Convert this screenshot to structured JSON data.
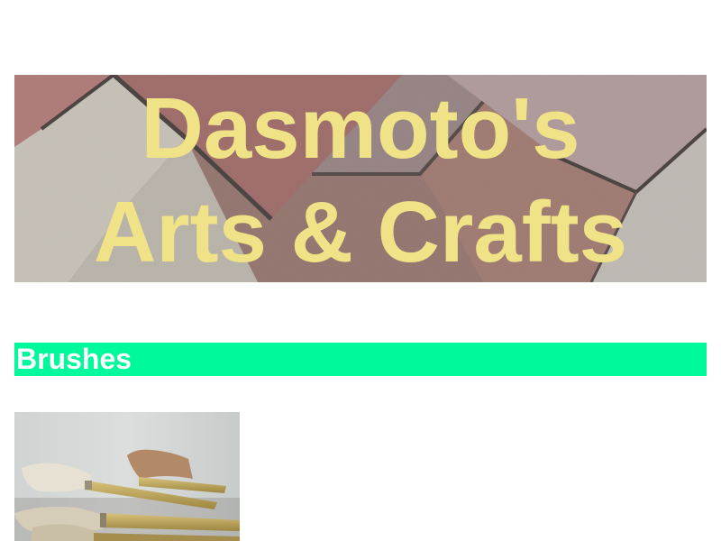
{
  "header": {
    "title_line1": "Dasmoto's",
    "title_line2": "Arts & Crafts",
    "title_color": "#efe287",
    "background_image": "brick-pavers-image"
  },
  "sections": [
    {
      "heading": "Brushes",
      "heading_bg_color": "#00f99a",
      "heading_text_color": "#ffffff",
      "image": "paint-brushes-image"
    }
  ]
}
